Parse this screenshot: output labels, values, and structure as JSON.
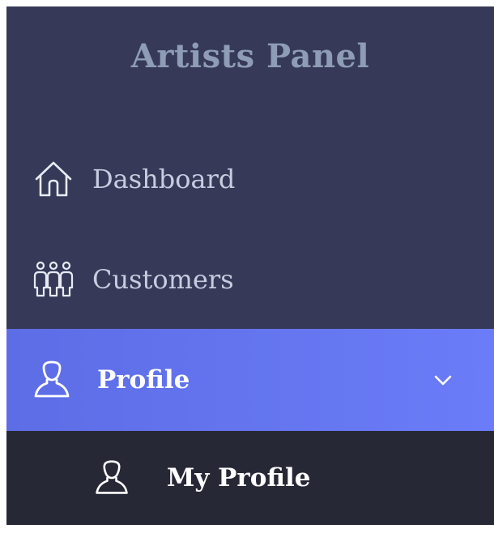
{
  "sidebar": {
    "brand": "Artists Panel",
    "items": [
      {
        "label": "Dashboard",
        "icon": "home-icon"
      },
      {
        "label": "Customers",
        "icon": "people-group-icon"
      },
      {
        "label": "Profile",
        "icon": "user-icon",
        "active": true,
        "expanded": true
      }
    ],
    "submenu": [
      {
        "label": "My Profile",
        "icon": "user-icon"
      }
    ]
  },
  "colors": {
    "sidebar_bg": "#363a58",
    "brand_text": "#8e9db5",
    "active_gradient_start": "#5d6de6",
    "active_gradient_end": "#6b7cf8",
    "submenu_bg": "#272836"
  }
}
